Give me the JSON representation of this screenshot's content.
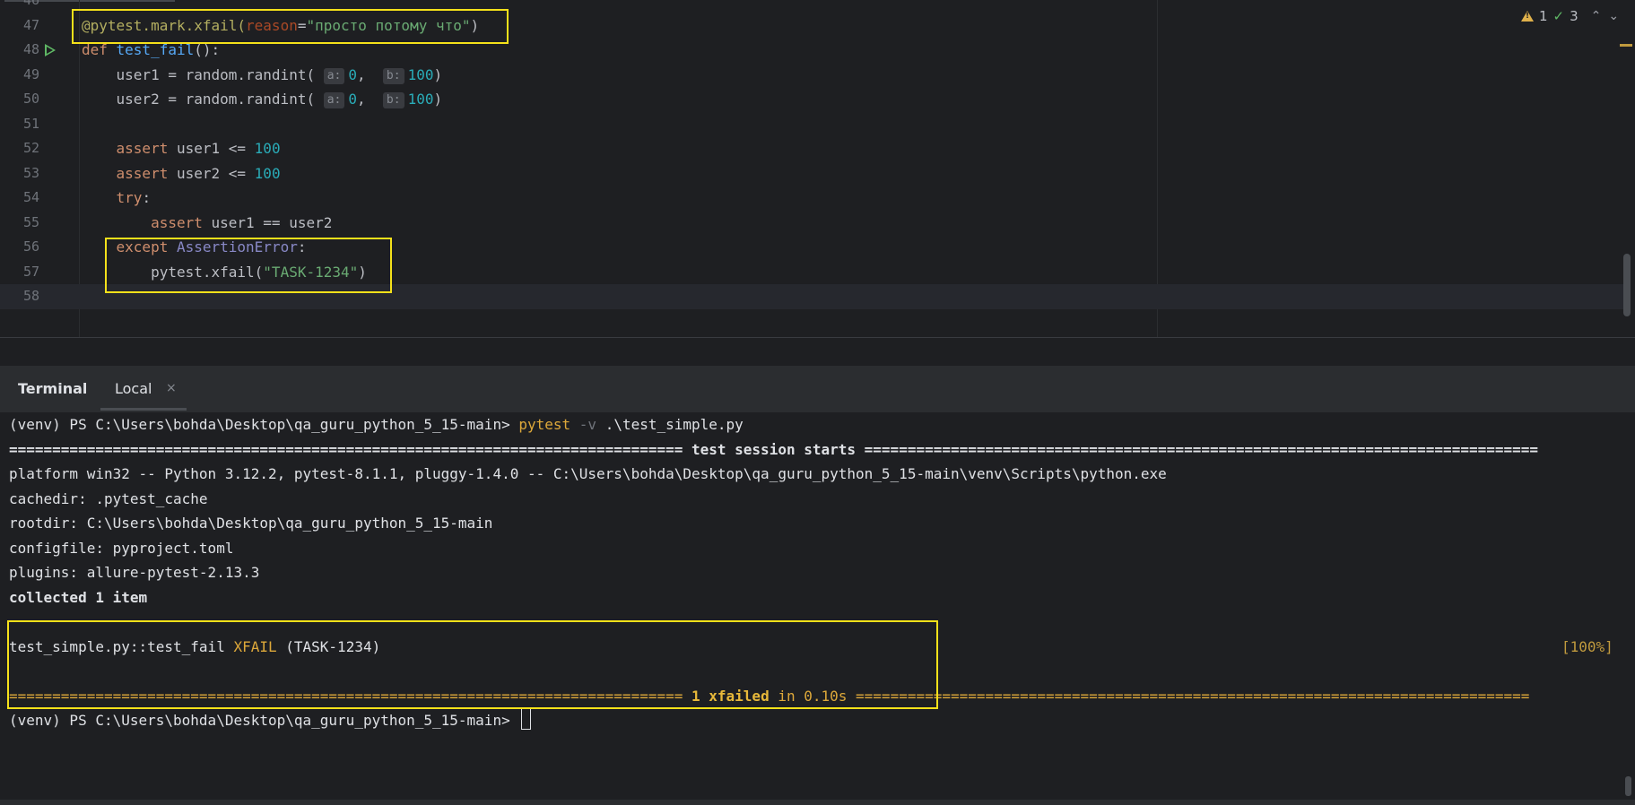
{
  "editor": {
    "top_partial_line_number": "46",
    "lines": [
      {
        "n": "47",
        "tokens": [
          [
            "dec",
            "@pytest.mark.xfail("
          ],
          [
            "param",
            "reason"
          ],
          [
            "",
            "="
          ],
          [
            "str",
            "\"просто потому что\""
          ],
          [
            "",
            ")"
          ]
        ]
      },
      {
        "n": "48",
        "tokens": [
          [
            "k",
            "def "
          ],
          [
            "fn",
            "test_fail"
          ],
          [
            "",
            "():"
          ]
        ]
      },
      {
        "n": "49",
        "tokens": [
          [
            "",
            "    user1 = random.randint( "
          ],
          [
            "hint",
            "a:"
          ],
          [
            "num",
            "0"
          ],
          [
            "",
            ",  "
          ],
          [
            "hint",
            "b:"
          ],
          [
            "num",
            "100"
          ],
          [
            "",
            ")"
          ]
        ]
      },
      {
        "n": "50",
        "tokens": [
          [
            "",
            "    user2 = random.randint( "
          ],
          [
            "hint",
            "a:"
          ],
          [
            "num",
            "0"
          ],
          [
            "",
            ",  "
          ],
          [
            "hint",
            "b:"
          ],
          [
            "num",
            "100"
          ],
          [
            "",
            ")"
          ]
        ]
      },
      {
        "n": "51",
        "tokens": []
      },
      {
        "n": "52",
        "tokens": [
          [
            "k",
            "    assert "
          ],
          [
            "",
            "user1 <= "
          ],
          [
            "num",
            "100"
          ]
        ]
      },
      {
        "n": "53",
        "tokens": [
          [
            "k",
            "    assert "
          ],
          [
            "",
            "user2 <= "
          ],
          [
            "num",
            "100"
          ]
        ]
      },
      {
        "n": "54",
        "tokens": [
          [
            "k",
            "    try"
          ],
          [
            "",
            ":"
          ]
        ]
      },
      {
        "n": "55",
        "tokens": [
          [
            "k",
            "        assert "
          ],
          [
            "",
            "user1 == user2"
          ]
        ]
      },
      {
        "n": "56",
        "tokens": [
          [
            "k",
            "    except "
          ],
          [
            "cls",
            "AssertionError"
          ],
          [
            "",
            ":"
          ]
        ]
      },
      {
        "n": "57",
        "tokens": [
          [
            "",
            "        pytest.xfail("
          ],
          [
            "str",
            "\"TASK-1234\""
          ],
          [
            "",
            ")"
          ]
        ]
      },
      {
        "n": "58",
        "tokens": [],
        "current": true
      }
    ],
    "inspections": {
      "warnings": "1",
      "ok": "3"
    }
  },
  "terminal": {
    "title": "Terminal",
    "tab_label": "Local",
    "tab_close": "×",
    "prompt": "(venv) PS C:\\Users\\bohda\\Desktop\\qa_guru_python_5_15-main> ",
    "command": "pytest",
    "command_flag": "-v",
    "command_arg": ".\\test_simple.py",
    "session_rule_left": "==============================================================================",
    "session_label": " test session starts ",
    "session_rule_right": "==============================================================================",
    "platform": "platform win32 -- Python 3.12.2, pytest-8.1.1, pluggy-1.4.0 -- C:\\Users\\bohda\\Desktop\\qa_guru_python_5_15-main\\venv\\Scripts\\python.exe",
    "cachedir": "cachedir: .pytest_cache",
    "rootdir": "rootdir: C:\\Users\\bohda\\Desktop\\qa_guru_python_5_15-main",
    "configfile": "configfile: pyproject.toml",
    "plugins": "plugins: allure-pytest-2.13.3",
    "collected": "collected 1 item",
    "result_test": "test_simple.py::test_fail ",
    "result_status": "XFAIL",
    "result_reason": " (TASK-1234)",
    "result_percent": "[100%]",
    "summary_rule_left": "============================================================================== ",
    "summary_count": "1 xfailed",
    "summary_time": " in 0.10s ",
    "summary_rule_right": "=============================================================================="
  }
}
